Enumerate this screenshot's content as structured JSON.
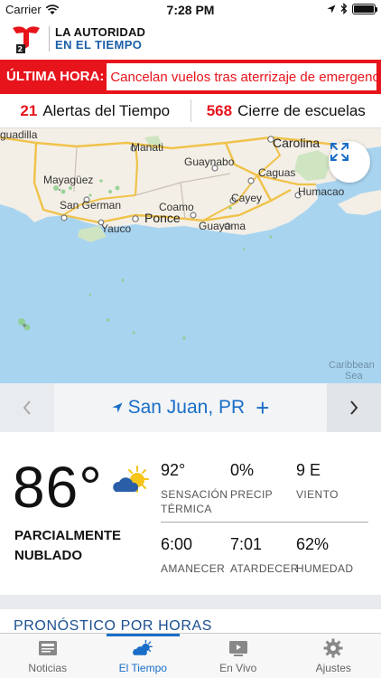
{
  "status_bar": {
    "carrier": "Carrier",
    "time": "7:28 PM"
  },
  "header": {
    "brand_line1": "LA AUTORIDAD",
    "brand_line2": "EN EL TIEMPO"
  },
  "breaking": {
    "tag": "ÚLTIMA HORA:",
    "text": "Cancelan vuelos tras aterrizaje de emergencia"
  },
  "alerts": [
    {
      "count": "21",
      "label": "Alertas del Tiempo"
    },
    {
      "count": "568",
      "label": "Cierre de escuelas"
    }
  ],
  "map": {
    "labels": {
      "guadilla": "guadilla",
      "manati": "Manati",
      "carolina": "Carolina",
      "guaynabo": "Guaynabo",
      "mayaguez": "Mayagüez",
      "caguas": "Caguas",
      "cayey": "Cayey",
      "humacao": "Humacao",
      "san_german": "San German",
      "coamo": "Coamo",
      "ponce": "Ponce",
      "guayama": "Guayama",
      "yauco": "Yauco",
      "caribbean_sea": "Caribbean",
      "caribbean_sea2": "Sea"
    }
  },
  "location": {
    "name": "San Juan, PR",
    "add": "+"
  },
  "current": {
    "temperature": "86°",
    "condition_line1": "PARCIALMENTE",
    "condition_line2": "NUBLADO",
    "stats": [
      {
        "value": "92°",
        "label1": "SENSACIÓN",
        "label2": "TÉRMICA"
      },
      {
        "value": "0%",
        "label1": "PRECIP",
        "label2": ""
      },
      {
        "value": "9 E",
        "label1": "VIENTO",
        "label2": ""
      },
      {
        "value": "6:00",
        "label1": "AMANECER",
        "label2": ""
      },
      {
        "value": "7:01",
        "label1": "ATARDECER",
        "label2": ""
      },
      {
        "value": "62%",
        "label1": "HUMEDAD",
        "label2": ""
      }
    ]
  },
  "section": {
    "hourly_title": "PRONÓSTICO POR HORAS"
  },
  "tabs": [
    {
      "label": "Noticias",
      "icon": "news-icon"
    },
    {
      "label": "El Tiempo",
      "icon": "weather-icon"
    },
    {
      "label": "En Vivo",
      "icon": "video-icon"
    },
    {
      "label": "Ajustes",
      "icon": "settings-icon"
    }
  ],
  "colors": {
    "brand_red": "#e8141c",
    "brand_blue": "#1a6ec8",
    "map_sea": "#a9d4f0",
    "map_land": "#f3efe6"
  }
}
